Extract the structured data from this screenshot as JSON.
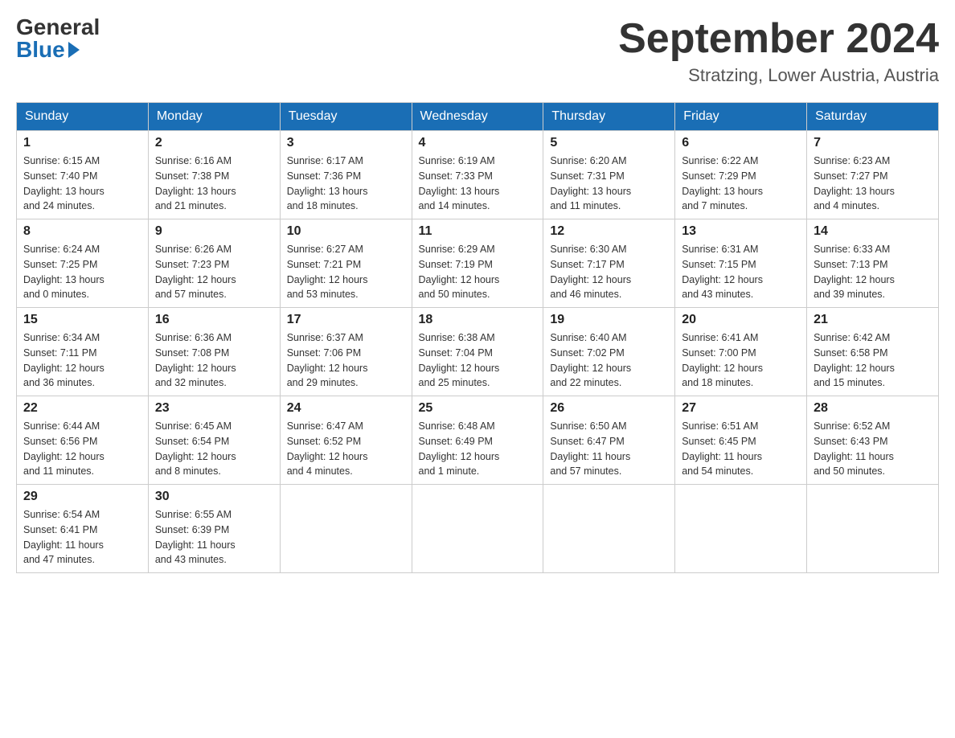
{
  "logo": {
    "general": "General",
    "blue": "Blue"
  },
  "title": "September 2024",
  "location": "Stratzing, Lower Austria, Austria",
  "days_of_week": [
    "Sunday",
    "Monday",
    "Tuesday",
    "Wednesday",
    "Thursday",
    "Friday",
    "Saturday"
  ],
  "weeks": [
    [
      {
        "date": "1",
        "sunrise": "6:15 AM",
        "sunset": "7:40 PM",
        "daylight": "13 hours and 24 minutes."
      },
      {
        "date": "2",
        "sunrise": "6:16 AM",
        "sunset": "7:38 PM",
        "daylight": "13 hours and 21 minutes."
      },
      {
        "date": "3",
        "sunrise": "6:17 AM",
        "sunset": "7:36 PM",
        "daylight": "13 hours and 18 minutes."
      },
      {
        "date": "4",
        "sunrise": "6:19 AM",
        "sunset": "7:33 PM",
        "daylight": "13 hours and 14 minutes."
      },
      {
        "date": "5",
        "sunrise": "6:20 AM",
        "sunset": "7:31 PM",
        "daylight": "13 hours and 11 minutes."
      },
      {
        "date": "6",
        "sunrise": "6:22 AM",
        "sunset": "7:29 PM",
        "daylight": "13 hours and 7 minutes."
      },
      {
        "date": "7",
        "sunrise": "6:23 AM",
        "sunset": "7:27 PM",
        "daylight": "13 hours and 4 minutes."
      }
    ],
    [
      {
        "date": "8",
        "sunrise": "6:24 AM",
        "sunset": "7:25 PM",
        "daylight": "13 hours and 0 minutes."
      },
      {
        "date": "9",
        "sunrise": "6:26 AM",
        "sunset": "7:23 PM",
        "daylight": "12 hours and 57 minutes."
      },
      {
        "date": "10",
        "sunrise": "6:27 AM",
        "sunset": "7:21 PM",
        "daylight": "12 hours and 53 minutes."
      },
      {
        "date": "11",
        "sunrise": "6:29 AM",
        "sunset": "7:19 PM",
        "daylight": "12 hours and 50 minutes."
      },
      {
        "date": "12",
        "sunrise": "6:30 AM",
        "sunset": "7:17 PM",
        "daylight": "12 hours and 46 minutes."
      },
      {
        "date": "13",
        "sunrise": "6:31 AM",
        "sunset": "7:15 PM",
        "daylight": "12 hours and 43 minutes."
      },
      {
        "date": "14",
        "sunrise": "6:33 AM",
        "sunset": "7:13 PM",
        "daylight": "12 hours and 39 minutes."
      }
    ],
    [
      {
        "date": "15",
        "sunrise": "6:34 AM",
        "sunset": "7:11 PM",
        "daylight": "12 hours and 36 minutes."
      },
      {
        "date": "16",
        "sunrise": "6:36 AM",
        "sunset": "7:08 PM",
        "daylight": "12 hours and 32 minutes."
      },
      {
        "date": "17",
        "sunrise": "6:37 AM",
        "sunset": "7:06 PM",
        "daylight": "12 hours and 29 minutes."
      },
      {
        "date": "18",
        "sunrise": "6:38 AM",
        "sunset": "7:04 PM",
        "daylight": "12 hours and 25 minutes."
      },
      {
        "date": "19",
        "sunrise": "6:40 AM",
        "sunset": "7:02 PM",
        "daylight": "12 hours and 22 minutes."
      },
      {
        "date": "20",
        "sunrise": "6:41 AM",
        "sunset": "7:00 PM",
        "daylight": "12 hours and 18 minutes."
      },
      {
        "date": "21",
        "sunrise": "6:42 AM",
        "sunset": "6:58 PM",
        "daylight": "12 hours and 15 minutes."
      }
    ],
    [
      {
        "date": "22",
        "sunrise": "6:44 AM",
        "sunset": "6:56 PM",
        "daylight": "12 hours and 11 minutes."
      },
      {
        "date": "23",
        "sunrise": "6:45 AM",
        "sunset": "6:54 PM",
        "daylight": "12 hours and 8 minutes."
      },
      {
        "date": "24",
        "sunrise": "6:47 AM",
        "sunset": "6:52 PM",
        "daylight": "12 hours and 4 minutes."
      },
      {
        "date": "25",
        "sunrise": "6:48 AM",
        "sunset": "6:49 PM",
        "daylight": "12 hours and 1 minute."
      },
      {
        "date": "26",
        "sunrise": "6:50 AM",
        "sunset": "6:47 PM",
        "daylight": "11 hours and 57 minutes."
      },
      {
        "date": "27",
        "sunrise": "6:51 AM",
        "sunset": "6:45 PM",
        "daylight": "11 hours and 54 minutes."
      },
      {
        "date": "28",
        "sunrise": "6:52 AM",
        "sunset": "6:43 PM",
        "daylight": "11 hours and 50 minutes."
      }
    ],
    [
      {
        "date": "29",
        "sunrise": "6:54 AM",
        "sunset": "6:41 PM",
        "daylight": "11 hours and 47 minutes."
      },
      {
        "date": "30",
        "sunrise": "6:55 AM",
        "sunset": "6:39 PM",
        "daylight": "11 hours and 43 minutes."
      },
      null,
      null,
      null,
      null,
      null
    ]
  ]
}
